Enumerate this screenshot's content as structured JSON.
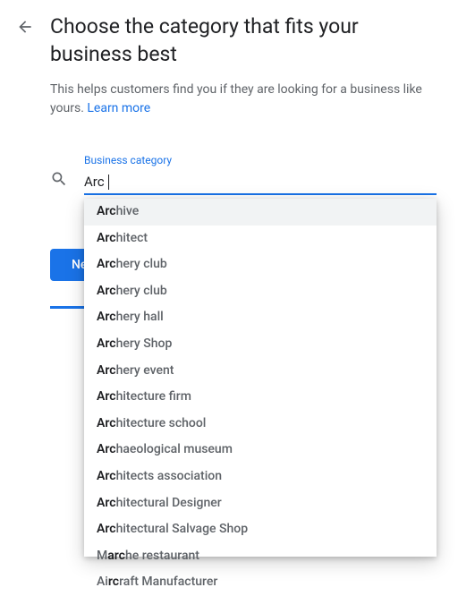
{
  "header": {
    "title": "Choose the category that fits your business best",
    "subtitle_prefix": "This helps customers find you if they are looking for a business like yours. ",
    "learn_more": "Learn more"
  },
  "form": {
    "label": "Business category",
    "input_value": "Arc",
    "next_label": "Ne"
  },
  "dropdown": {
    "query": "Arc",
    "items": [
      {
        "match": "Arc",
        "rest": "hive"
      },
      {
        "match": "Arc",
        "rest": "hitect"
      },
      {
        "match": "Arc",
        "rest": "hery club"
      },
      {
        "match": "Arc",
        "rest": "hery club"
      },
      {
        "match": "Arc",
        "rest": "hery hall"
      },
      {
        "match": "Arc",
        "rest": "hery Shop"
      },
      {
        "match": "Arc",
        "rest": "hery event"
      },
      {
        "match": "Arc",
        "rest": "hitecture firm"
      },
      {
        "match": "Arc",
        "rest": "hitecture school"
      },
      {
        "match": "Arc",
        "rest": "haeological museum"
      },
      {
        "match": "Arc",
        "rest": "hitects association"
      },
      {
        "match": "Arc",
        "rest": "hitectural Designer"
      },
      {
        "match": "Arc",
        "rest": "hitectural Salvage Shop"
      },
      {
        "prefix": "M",
        "match": "arc",
        "rest": "he restaurant"
      },
      {
        "prefix": "Ai",
        "match": "rc",
        "rest": "raft Manufacturer"
      }
    ]
  }
}
